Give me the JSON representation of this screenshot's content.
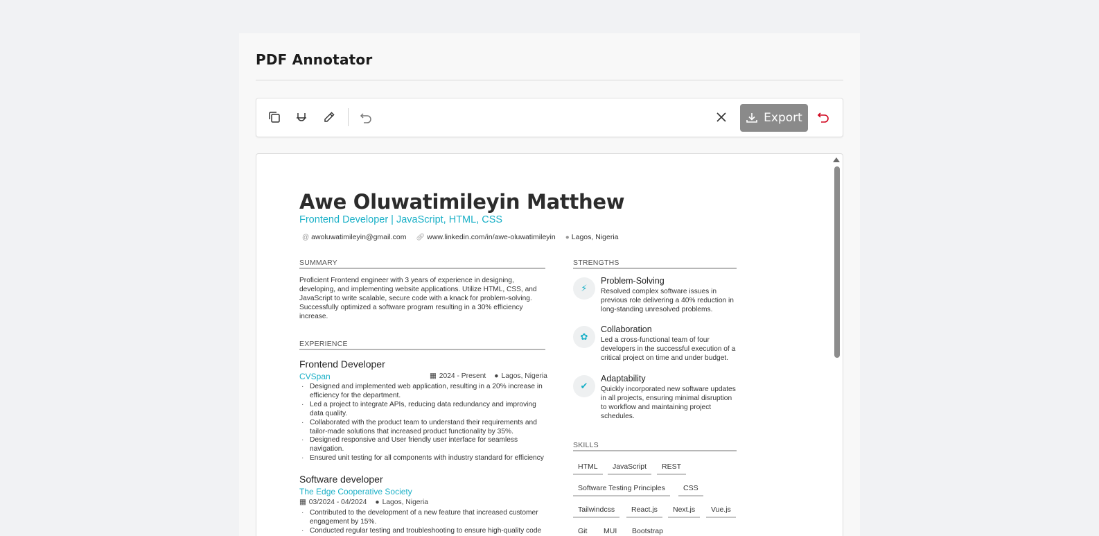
{
  "app": {
    "title": "PDF Annotator"
  },
  "toolbar": {
    "tools": [
      {
        "icon": "copy-icon"
      },
      {
        "icon": "underline-icon"
      },
      {
        "icon": "pencil-icon"
      },
      {
        "icon": "undo-icon"
      }
    ],
    "close_icon": "close-icon",
    "export_label": "Export",
    "export_icon": "download-icon",
    "reset_icon": "reset-icon",
    "colors": {
      "export_bg": "#8a8a8a",
      "reset": "#d0021b",
      "accent": "#1ab0c7"
    }
  },
  "resume": {
    "name": "Awe Oluwatimileyin Matthew",
    "role": "Frontend Developer | JavaScript, HTML, CSS",
    "contacts": {
      "email": "awoluwatimileyin@gmail.com",
      "linkedin": "www.linkedin.com/in/awe-oluwatimileyin",
      "location": "Lagos, Nigeria"
    },
    "summary": {
      "heading": "SUMMARY",
      "text": "Proficient Frontend engineer with 3 years of experience in designing, developing, and implementing website applications. Utilize HTML, CSS, and JavaScript to write scalable, secure code with a knack for problem-solving. Successfully optimized a software program resulting in a 30% efficiency increase."
    },
    "experience": {
      "heading": "EXPERIENCE",
      "jobs": [
        {
          "title": "Frontend Developer",
          "company": "CVSpan",
          "dates": "2024 - Present",
          "location": "Lagos, Nigeria",
          "bullets": [
            "Designed and implemented web application, resulting in a 20% increase in efficiency for the department.",
            "Led a project to integrate APIs, reducing data redundancy and improving data quality.",
            "Collaborated with the product team to understand their requirements and tailor-made solutions that increased product functionality by 35%.",
            "Designed responsive and User friendly user interface for seamless navigation.",
            "Ensured unit testing for all components with industry standard for efficiency"
          ]
        },
        {
          "title": "Software developer",
          "company": "The Edge Cooperative Society",
          "dates": "03/2024 - 04/2024",
          "location": "Lagos, Nigeria",
          "bullets": [
            "Contributed to the development of a new feature that increased customer engagement by 15%.",
            "Conducted regular testing and troubleshooting to ensure high-quality code"
          ]
        }
      ]
    },
    "strengths": {
      "heading": "STRENGTHS",
      "items": [
        {
          "icon": "bolt-icon",
          "title": "Problem-Solving",
          "text": "Resolved complex software issues in previous role delivering a 40% reduction in long-standing unresolved problems."
        },
        {
          "icon": "award-icon",
          "title": "Collaboration",
          "text": "Led a cross-functional team of four developers in the successful execution of a critical project on time and under budget."
        },
        {
          "icon": "check-icon",
          "title": "Adaptability",
          "text": "Quickly incorporated new software updates in all projects, ensuring minimal disruption to workflow and maintaining project schedules."
        }
      ]
    },
    "skills": {
      "heading": "SKILLS",
      "items": [
        "HTML",
        "JavaScript",
        "REST",
        "Software Testing Principles",
        "CSS",
        "Tailwindcss",
        "React.js",
        "Next.js",
        "Vue.js",
        "Git",
        "MUI",
        "Bootstrap"
      ]
    }
  }
}
